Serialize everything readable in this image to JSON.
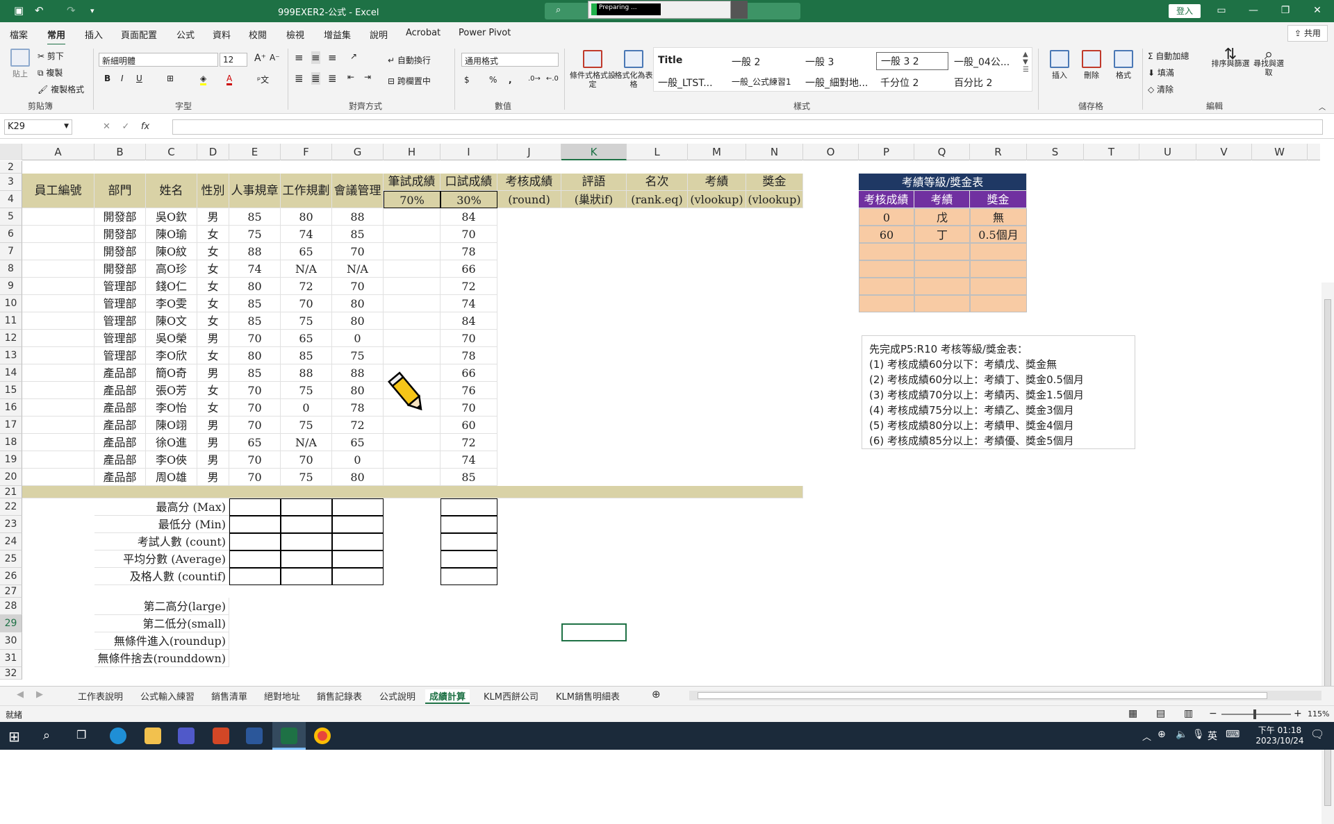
{
  "window": {
    "title": "999EXER2-公式  -  Excel",
    "preparing": "Preparing ...",
    "login_label": "登入",
    "share_label": "共用"
  },
  "menu": {
    "items": [
      "檔案",
      "常用",
      "插入",
      "頁面配置",
      "公式",
      "資料",
      "校閱",
      "檢視",
      "增益集",
      "說明",
      "Acrobat",
      "Power Pivot"
    ]
  },
  "ribbon": {
    "clipboard": {
      "paste": "貼上",
      "cut": "剪下",
      "copy": "複製",
      "format_painter": "複製格式",
      "group": "剪貼簿"
    },
    "font": {
      "name": "新細明體",
      "size": "12",
      "group": "字型"
    },
    "alignment": {
      "wrap": "自動換行",
      "merge": "跨欄置中",
      "group": "對齊方式"
    },
    "number": {
      "format": "通用格式",
      "group": "數值"
    },
    "styles": {
      "conditional": "條件式格式設定",
      "table": "格式化為表格",
      "cells": [
        "Title",
        "一般 2",
        "一般 3",
        "一般 3 2",
        "一般_04公...",
        "一般_LTST...",
        "一般_公式練習1",
        "一般_細對地...",
        "千分位 2",
        "百分比 2"
      ],
      "group": "樣式"
    },
    "cells": {
      "insert": "插入",
      "delete": "刪除",
      "format": "格式",
      "group": "儲存格"
    },
    "editing": {
      "autosum": "自動加總",
      "fill": "填滿",
      "clear": "清除",
      "sort": "排序與篩選",
      "find": "尋找與選取",
      "group": "編輯"
    }
  },
  "formula_bar": {
    "name_box": "K29",
    "formula": ""
  },
  "columns": [
    "A",
    "B",
    "C",
    "D",
    "E",
    "F",
    "G",
    "H",
    "I",
    "J",
    "K",
    "L",
    "M",
    "N",
    "O",
    "P",
    "Q",
    "R",
    "S",
    "T",
    "U",
    "V",
    "W"
  ],
  "rows": [
    "2",
    "3",
    "4",
    "5",
    "6",
    "7",
    "8",
    "9",
    "10",
    "11",
    "12",
    "13",
    "14",
    "15",
    "16",
    "17",
    "18",
    "19",
    "20",
    "21",
    "22",
    "23",
    "24",
    "25",
    "26",
    "27",
    "28",
    "29",
    "30",
    "31",
    "32"
  ],
  "headers": {
    "emp_id": "員工編號",
    "dept": "部門",
    "name": "姓名",
    "gender": "性別",
    "hr": "人事規章",
    "work": "工作規劃",
    "meeting": "會議管理",
    "written": "筆試成績",
    "written_pct": "70%",
    "oral": "口試成績",
    "oral_pct": "30%",
    "score": "考核成績",
    "score_sub": "(round)",
    "comment": "評語",
    "comment_sub": "(巢狀if)",
    "rank": "名次",
    "rank_sub": "(rank.eq)",
    "grade": "考績",
    "grade_sub": "(vlookup)",
    "bonus": "獎金",
    "bonus_sub": "(vlookup)"
  },
  "employees": [
    {
      "dept": "開發部",
      "name": "吳O欽",
      "gender": "男",
      "e": "85",
      "f": "80",
      "g": "88",
      "i": "84"
    },
    {
      "dept": "開發部",
      "name": "陳O瑜",
      "gender": "女",
      "e": "75",
      "f": "74",
      "g": "85",
      "i": "70"
    },
    {
      "dept": "開發部",
      "name": "陳O紋",
      "gender": "女",
      "e": "88",
      "f": "65",
      "g": "70",
      "i": "78"
    },
    {
      "dept": "開發部",
      "name": "高O珍",
      "gender": "女",
      "e": "74",
      "f": "N/A",
      "g": "N/A",
      "i": "66"
    },
    {
      "dept": "管理部",
      "name": "錢O仁",
      "gender": "女",
      "e": "80",
      "f": "72",
      "g": "70",
      "i": "72"
    },
    {
      "dept": "管理部",
      "name": "李O雯",
      "gender": "女",
      "e": "85",
      "f": "70",
      "g": "80",
      "i": "74"
    },
    {
      "dept": "管理部",
      "name": "陳O文",
      "gender": "女",
      "e": "85",
      "f": "75",
      "g": "80",
      "i": "84"
    },
    {
      "dept": "管理部",
      "name": "吳O榮",
      "gender": "男",
      "e": "70",
      "f": "65",
      "g": "0",
      "i": "70"
    },
    {
      "dept": "管理部",
      "name": "李O欣",
      "gender": "女",
      "e": "80",
      "f": "85",
      "g": "75",
      "i": "78"
    },
    {
      "dept": "產品部",
      "name": "簡O奇",
      "gender": "男",
      "e": "85",
      "f": "88",
      "g": "88",
      "i": "66"
    },
    {
      "dept": "產品部",
      "name": "張O芳",
      "gender": "女",
      "e": "70",
      "f": "75",
      "g": "80",
      "i": "76"
    },
    {
      "dept": "產品部",
      "name": "李O怡",
      "gender": "女",
      "e": "70",
      "f": "0",
      "g": "78",
      "i": "70"
    },
    {
      "dept": "產品部",
      "name": "陳O翊",
      "gender": "男",
      "e": "70",
      "f": "75",
      "g": "72",
      "i": "60"
    },
    {
      "dept": "產品部",
      "name": "徐O進",
      "gender": "男",
      "e": "65",
      "f": "N/A",
      "g": "65",
      "i": "72"
    },
    {
      "dept": "產品部",
      "name": "李O俠",
      "gender": "男",
      "e": "70",
      "f": "70",
      "g": "0",
      "i": "74"
    },
    {
      "dept": "產品部",
      "name": "周O雄",
      "gender": "男",
      "e": "70",
      "f": "75",
      "g": "80",
      "i": "85"
    }
  ],
  "stats_labels": [
    "最高分 (Max)",
    "最低分 (Min)",
    "考試人數 (count)",
    "平均分數 (Average)",
    "及格人數 (countif)"
  ],
  "extra_labels": [
    "第二高分(large)",
    "第二低分(small)",
    "無條件進入(roundup)",
    "無條件捨去(rounddown)"
  ],
  "grade_table": {
    "title": "考績等級/獎金表",
    "headers": [
      "考核成績",
      "考績",
      "獎金"
    ],
    "rows": [
      [
        "0",
        "戊",
        "無"
      ],
      [
        "60",
        "丁",
        "0.5個月"
      ],
      [
        "",
        "",
        ""
      ],
      [
        "",
        "",
        ""
      ],
      [
        "",
        "",
        ""
      ],
      [
        "",
        "",
        ""
      ]
    ]
  },
  "note": {
    "title": "先完成P5:R10 考核等級/獎金表：",
    "lines": [
      "(1) 考核成績60分以下：考績戊、獎金無",
      "(2) 考核成績60分以上：考績丁、獎金0.5個月",
      "(3) 考核成績70分以上：考績丙、獎金1.5個月",
      "(4) 考核成績75分以上：考績乙、獎金3個月",
      "(5) 考核成績80分以上：考績甲、獎金4個月",
      "(6) 考核成績85分以上：考績優、獎金5個月"
    ]
  },
  "sheet_tabs": [
    "工作表說明",
    "公式輸入練習",
    "銷售清單",
    "絕對地址",
    "銷售記錄表",
    "公式說明",
    "成績計算",
    "KLM西餅公司",
    "KLM銷售明細表"
  ],
  "active_tab": "成績計算",
  "status": {
    "ready": "就緒",
    "zoom": "115%"
  },
  "taskbar": {
    "ime": "英",
    "time": "下午 01:18",
    "date": "2023/10/24"
  }
}
